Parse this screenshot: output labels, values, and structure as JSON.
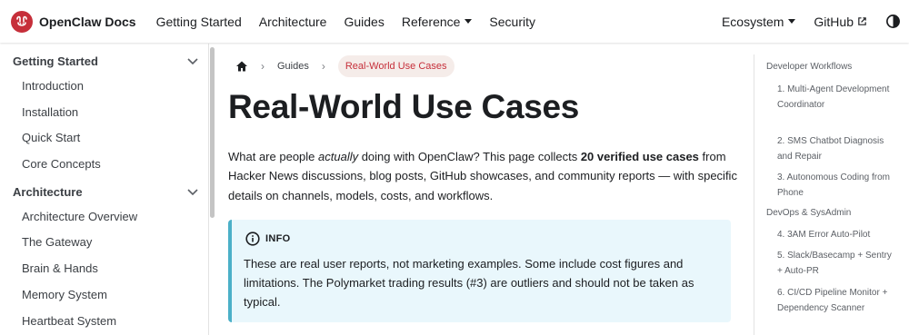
{
  "navbar": {
    "brand": "OpenClaw Docs",
    "links": [
      "Getting Started",
      "Architecture",
      "Guides",
      "Reference",
      "Security"
    ],
    "right": [
      "Ecosystem",
      "GitHub"
    ],
    "accent": "#c62f3a"
  },
  "sidebar": {
    "categories": [
      {
        "label": "Getting Started",
        "items": [
          "Introduction",
          "Installation",
          "Quick Start",
          "Core Concepts"
        ]
      },
      {
        "label": "Architecture",
        "items": [
          "Architecture Overview",
          "The Gateway",
          "Brain & Hands",
          "Memory System",
          "Heartbeat System"
        ]
      }
    ]
  },
  "breadcrumbs": [
    "Guides",
    "Real-World Use Cases"
  ],
  "page": {
    "title": "Real-World Use Cases",
    "intro": {
      "p1": "What are people ",
      "em": "actually",
      "p2": " doing with OpenClaw? This page collects ",
      "strong": "20 verified use cases",
      "p3": " from Hacker News discussions, blog posts, GitHub showcases, and community reports — with specific details on channels, models, costs, and workflows."
    }
  },
  "admonition": {
    "label": "INFO",
    "body": "These are real user reports, not marketing examples. Some include cost figures and limitations. The Polymarket trading results (#3) are outliers and should not be taken as typical."
  },
  "toc": {
    "sections": [
      {
        "heading": "Developer Workflows",
        "items": [
          "1. Multi-Agent Development Coordinator",
          "2. SMS Chatbot Diagnosis and Repair",
          "3. Autonomous Coding from Phone"
        ]
      },
      {
        "heading": "DevOps & SysAdmin",
        "items": [
          "4. 3AM Error Auto-Pilot",
          "5. Slack/Basecamp + Sentry + Auto-PR",
          "6. CI/CD Pipeline Monitor + Dependency Scanner"
        ]
      }
    ]
  }
}
